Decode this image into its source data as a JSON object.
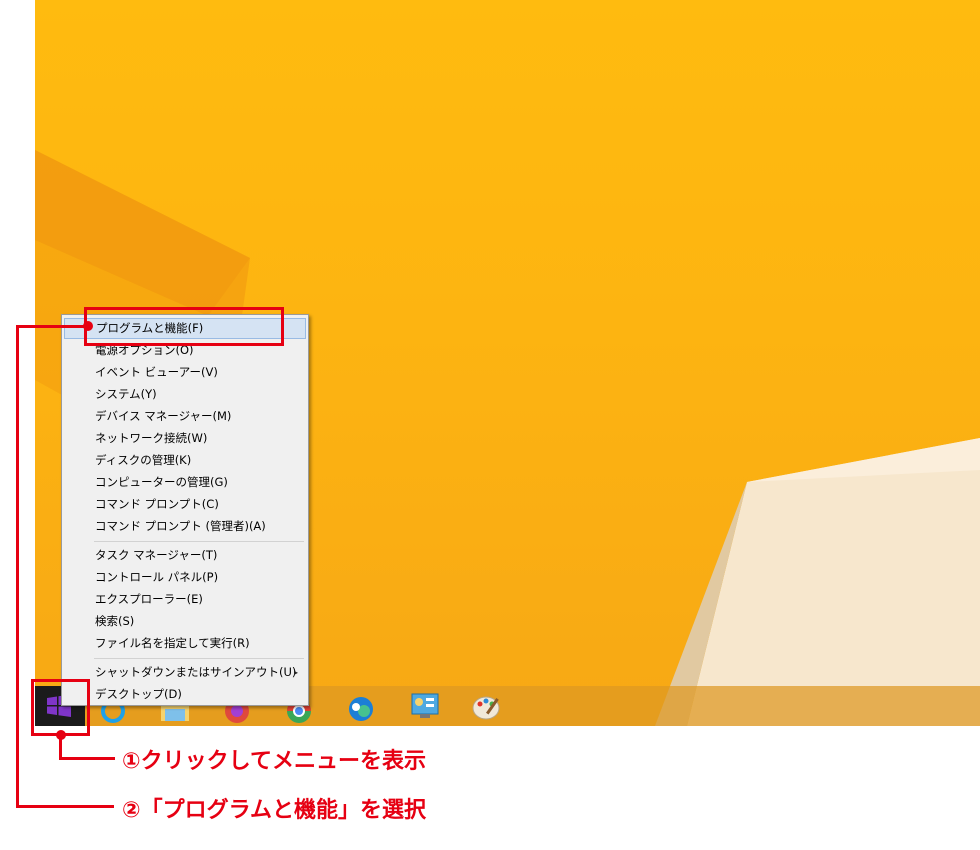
{
  "context_menu": {
    "groups": [
      [
        "プログラムと機能(F)",
        "電源オプション(O)",
        "イベント ビューアー(V)",
        "システム(Y)",
        "デバイス マネージャー(M)",
        "ネットワーク接続(W)",
        "ディスクの管理(K)",
        "コンピューターの管理(G)",
        "コマンド プロンプト(C)",
        "コマンド プロンプト (管理者)(A)"
      ],
      [
        "タスク マネージャー(T)",
        "コントロール パネル(P)",
        "エクスプローラー(E)",
        "検索(S)",
        "ファイル名を指定して実行(R)"
      ],
      [
        "シャットダウンまたはサインアウト(U)",
        "デスクトップ(D)"
      ]
    ],
    "highlighted": "プログラムと機能(F)",
    "submenu_arrow": "▸"
  },
  "annotations": {
    "step1": "①クリックしてメニューを表示",
    "step2": "②「プログラムと機能」を選択",
    "color": "#e60012"
  },
  "taskbar": {
    "icons": [
      "start-icon",
      "internet-explorer-icon",
      "file-explorer-icon",
      "firefox-icon",
      "chrome-icon",
      "edge-icon",
      "control-panel-icon",
      "paint-icon"
    ]
  }
}
